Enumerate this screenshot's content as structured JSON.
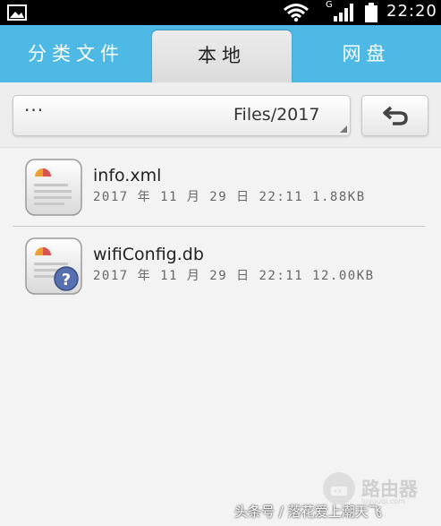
{
  "status_bar": {
    "network_letter": "G",
    "time": "22:20"
  },
  "tabs": {
    "left": "分类文件",
    "active": "本地",
    "right": "网盘"
  },
  "path": {
    "ellipsis": "···",
    "current": "Files/2017"
  },
  "files": [
    {
      "name": "info.xml",
      "meta": "2017 年 11 月 29 日 22:11 1.88KB",
      "icon": "xml-document-icon"
    },
    {
      "name": "wifiConfig.db",
      "meta": "2017 年 11 月 29 日 22:11 12.00KB",
      "icon": "unknown-document-icon"
    }
  ],
  "watermark": {
    "credit": "头条号 / 落花爱上潮天飞",
    "logo_text": "路由器",
    "logo_sub": "luyouqi.com"
  }
}
